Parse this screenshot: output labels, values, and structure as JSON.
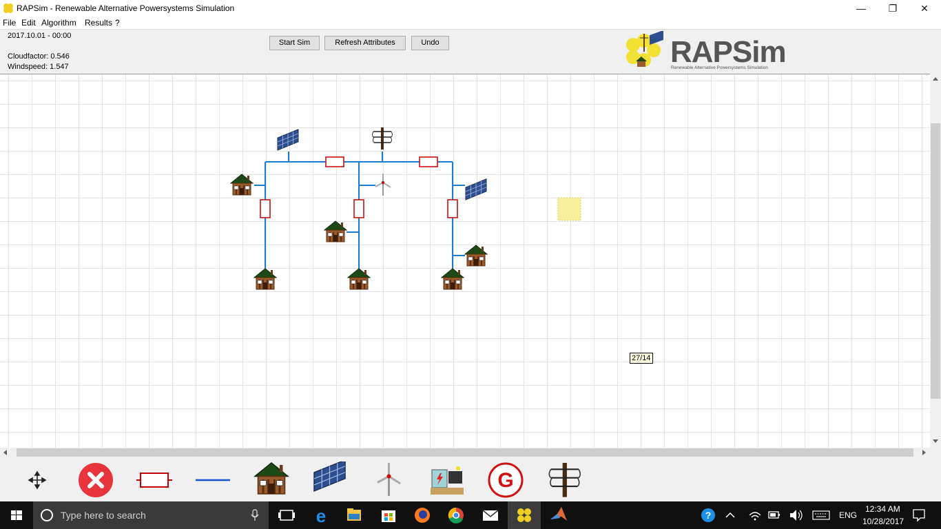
{
  "window": {
    "title": "RAPSim - Renewable Alternative Powersystems Simulation",
    "minimize": "—",
    "maximize": "❐",
    "close": "✕"
  },
  "menu": [
    "File",
    "Edit",
    "Algorithm",
    "Results",
    "?"
  ],
  "info": {
    "datetime": "2017.10.01 - 00:00",
    "cloudfactor": "Cloudfactor: 0.546",
    "windspeed": "Windspeed: 1.547"
  },
  "toolbar": {
    "start_sim": "Start Sim",
    "refresh_attributes": "Refresh Attributes",
    "undo": "Undo"
  },
  "logo": {
    "name": "RAPSim",
    "subtitle": "Renewable Alternative Powersystems Simulation"
  },
  "canvas": {
    "coordinate_readout": "27/14",
    "components": [
      "solar-panel",
      "solar-panel",
      "wind-turbine",
      "transformer-pole",
      "house",
      "house",
      "house",
      "house",
      "house",
      "house",
      "resistor",
      "resistor",
      "resistor",
      "resistor",
      "resistor"
    ]
  },
  "toolbox": [
    "move-icon",
    "delete-icon",
    "resistor-icon",
    "cable-icon",
    "house-icon",
    "solar-panel-icon",
    "wind-turbine-icon",
    "battery-station-icon",
    "generator-icon",
    "transformer-pole-icon"
  ],
  "taskbar": {
    "search_placeholder": "Type here to search",
    "language": "ENG",
    "time": "12:34 AM",
    "date": "10/28/2017"
  },
  "colors": {
    "grid_line": "#e3e3e3",
    "cable": "#1a7fd4",
    "resistor": "#c00000",
    "selection": "#f7f29a",
    "taskbar": "#101010"
  }
}
